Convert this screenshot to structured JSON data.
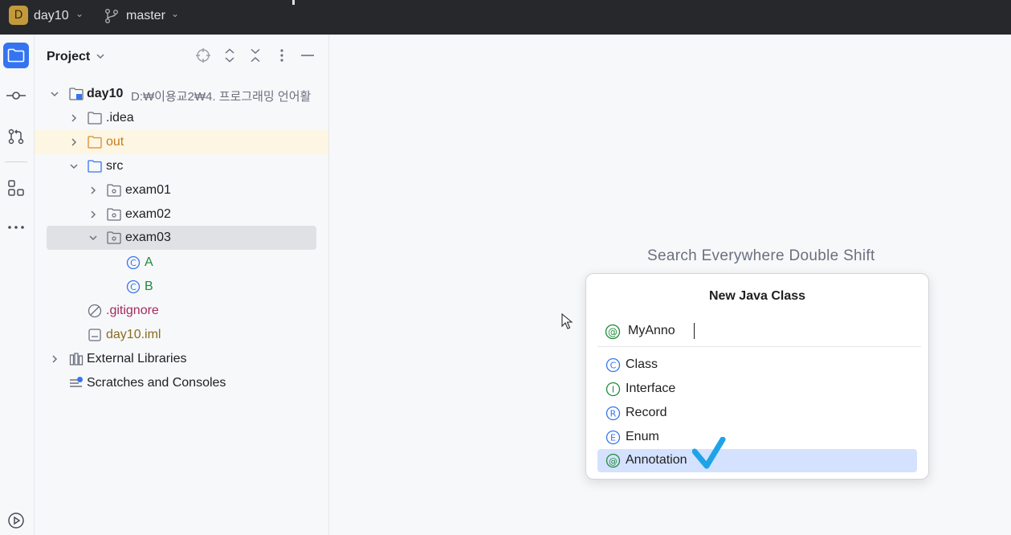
{
  "titlebar": {
    "project_badge": "D",
    "project_name": "day10",
    "branch_name": "master"
  },
  "tool_stripe": {
    "items": [
      {
        "name": "project",
        "icon": "folder-icon",
        "active": true
      },
      {
        "name": "commit",
        "icon": "commit-icon",
        "active": false
      },
      {
        "name": "pull-requests",
        "icon": "pull-request-icon",
        "active": false
      },
      {
        "name": "structure",
        "icon": "structure-icon",
        "active": false
      },
      {
        "name": "more",
        "icon": "more-icon",
        "active": false
      },
      {
        "name": "run",
        "icon": "run-icon",
        "active": false
      }
    ]
  },
  "project_panel": {
    "title": "Project",
    "tree": [
      {
        "label": "day10",
        "path": "D:₩이용교2₩4. 프로그래밍 언어활",
        "icon": "module-folder-icon",
        "expanded": true
      },
      {
        "label": ".idea",
        "icon": "folder-icon",
        "expanded": false
      },
      {
        "label": "out",
        "icon": "excluded-folder-icon",
        "expanded": false
      },
      {
        "label": "src",
        "icon": "source-folder-icon",
        "expanded": true
      },
      {
        "label": "exam01",
        "icon": "package-icon",
        "expanded": false
      },
      {
        "label": "exam02",
        "icon": "package-icon",
        "expanded": false
      },
      {
        "label": "exam03",
        "icon": "package-icon",
        "expanded": true,
        "selected": true
      },
      {
        "label": "A",
        "icon": "class-icon"
      },
      {
        "label": "B",
        "icon": "class-icon"
      },
      {
        "label": ".gitignore",
        "icon": "ignore-file-icon"
      },
      {
        "label": "day10.iml",
        "icon": "iml-file-icon"
      },
      {
        "label": "External Libraries",
        "icon": "library-icon",
        "expanded": false
      },
      {
        "label": "Scratches and Consoles",
        "icon": "scratches-icon"
      }
    ]
  },
  "editor": {
    "hint": "Search Everywhere Double Shift"
  },
  "new_class_dialog": {
    "title": "New Java Class",
    "input_value": "MyAnno",
    "options": [
      {
        "label": "Class",
        "icon": "class-icon",
        "letter": "C",
        "color": "#3574f0"
      },
      {
        "label": "Interface",
        "icon": "interface-icon",
        "letter": "I",
        "color": "#208a3c"
      },
      {
        "label": "Record",
        "icon": "record-icon",
        "letter": "R",
        "color": "#3574f0"
      },
      {
        "label": "Enum",
        "icon": "enum-icon",
        "letter": "E",
        "color": "#3574f0"
      },
      {
        "label": "Annotation",
        "icon": "annotation-icon",
        "letter": "@",
        "color": "#208a3c",
        "selected": true
      }
    ]
  },
  "colors": {
    "accent": "#3574f0",
    "selection": "#d4e2ff",
    "excluded_label": "#c77d1c",
    "class_label": "#208a3c",
    "ignored_label": "#a52a5a",
    "iml_label": "#8b6b1f",
    "checkmark": "#1fa3e8"
  }
}
